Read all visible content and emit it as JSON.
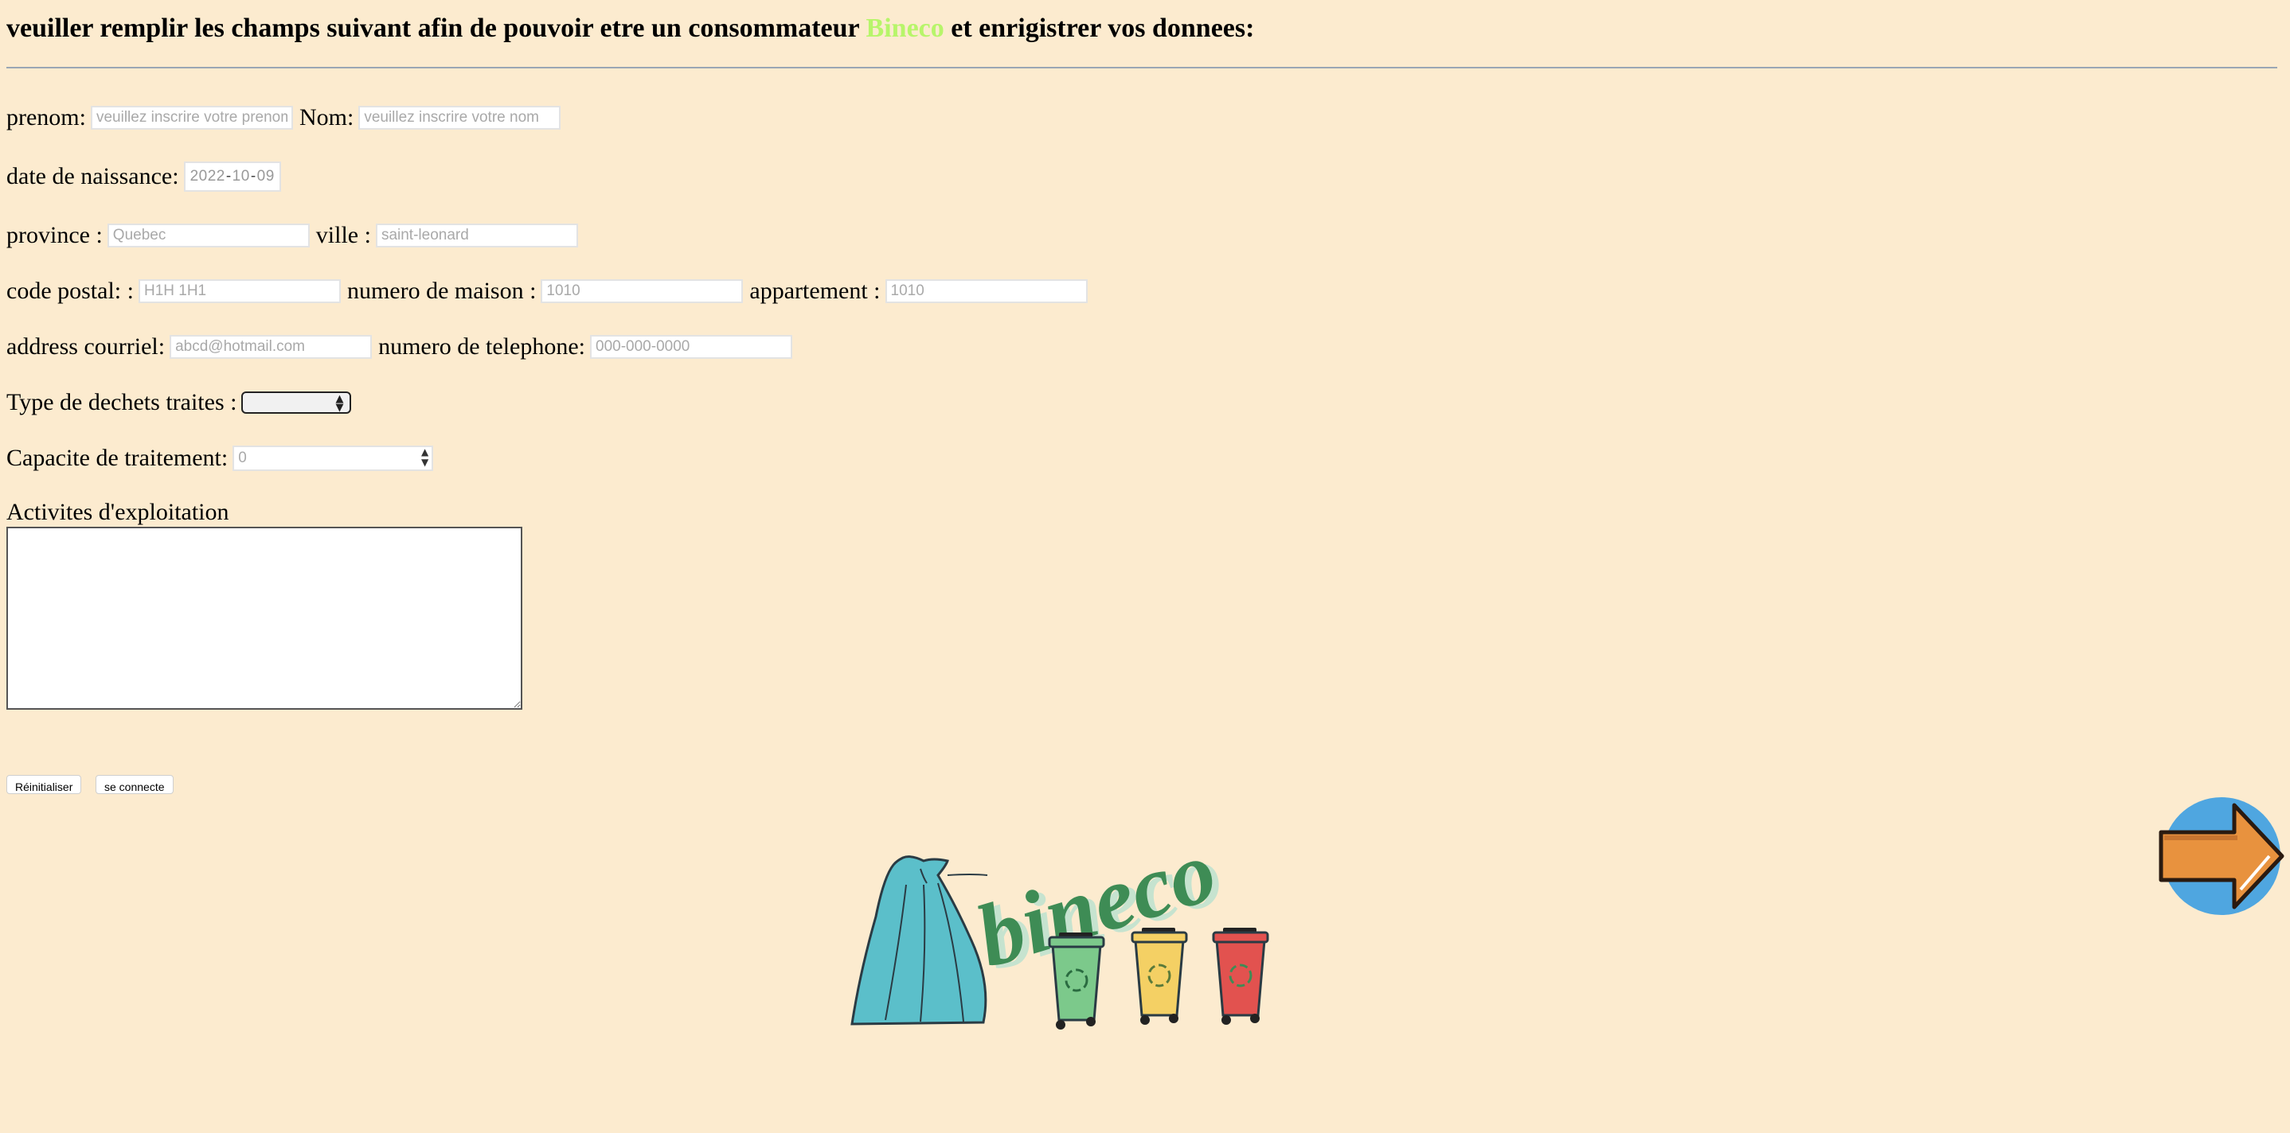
{
  "header": {
    "title_before": "veuiller remplir les champs suivant afin de pouvoir etre un consommateur",
    "brand": "Bineco",
    "title_after": "et enrigistrer vos donnees:",
    "brand_color": "#b7f56a"
  },
  "form": {
    "prenom": {
      "label": "prenom:",
      "placeholder": "veuillez inscrire votre prenom"
    },
    "nom": {
      "label": "Nom:",
      "placeholder": "veuillez inscrire votre nom"
    },
    "naissance": {
      "label": "date de naissance:",
      "year": "2022",
      "month": "10",
      "day": "09"
    },
    "province": {
      "label": "province :",
      "placeholder": "Quebec"
    },
    "ville": {
      "label": "ville :",
      "placeholder": "saint-leonard"
    },
    "code_postal": {
      "label": "code postal: :",
      "placeholder": "H1H 1H1"
    },
    "numero_maison": {
      "label": "numero de maison :",
      "placeholder": "1010"
    },
    "appartement": {
      "label": "appartement :",
      "placeholder": "1010"
    },
    "courriel": {
      "label": "address courriel:",
      "placeholder": "abcd@hotmail.com"
    },
    "telephone": {
      "label": "numero de telephone:",
      "placeholder": "000-000-0000"
    },
    "type_dechets": {
      "label": "Type de dechets traites :",
      "selected": ""
    },
    "capacite": {
      "label": "Capacite de traitement:",
      "placeholder": "0"
    },
    "activites": {
      "label": "Activites d'exploitation",
      "value": ""
    }
  },
  "buttons": {
    "reset": "Réinitialiser",
    "submit": "se connecte"
  },
  "logo": {
    "wordmark": "bineco"
  },
  "icons": {
    "next": "right-arrow-icon",
    "bag": "trash-bag-icon",
    "bins": "recycling-bin-icon"
  },
  "colors": {
    "background": "#fcebcf",
    "logo_green": "#3e8c55",
    "arrow_orange": "#e8923e",
    "arrow_circle": "#4fa6e0"
  }
}
